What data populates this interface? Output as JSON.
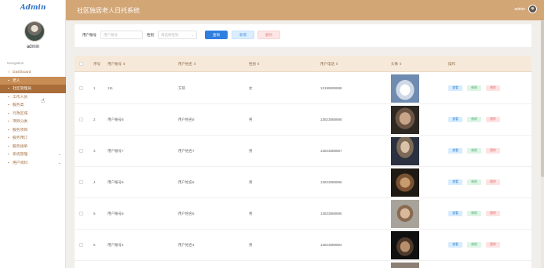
{
  "sidebar": {
    "brand": "Admin",
    "username": "admin",
    "nav_caption": "Navigation",
    "items": [
      {
        "icon": "○",
        "label": "Dashboard",
        "state": "normal",
        "chevron": false
      },
      {
        "icon": "▪",
        "label": "老人",
        "state": "active",
        "chevron": false
      },
      {
        "icon": "▪",
        "label": "社区管理员",
        "state": "active2",
        "chevron": false
      },
      {
        "icon": "▪",
        "label": "工作人员",
        "state": "normal",
        "chevron": false
      },
      {
        "icon": "▪",
        "label": "服务类",
        "state": "normal",
        "chevron": false
      },
      {
        "icon": "▪",
        "label": "行政区域",
        "state": "normal",
        "chevron": false
      },
      {
        "icon": "▪",
        "label": "项目分类",
        "state": "normal",
        "chevron": false
      },
      {
        "icon": "▪",
        "label": "服务项目",
        "state": "normal",
        "chevron": false
      },
      {
        "icon": "▪",
        "label": "服务预订",
        "state": "normal",
        "chevron": false
      },
      {
        "icon": "▪",
        "label": "服务接单",
        "state": "normal",
        "chevron": false
      },
      {
        "icon": "▪",
        "label": "系统管理",
        "state": "normal",
        "chevron": true
      },
      {
        "icon": "▪",
        "label": "用户资料",
        "state": "normal",
        "chevron": true
      }
    ]
  },
  "header": {
    "title": "社区独居老人日托系统",
    "user": "admin"
  },
  "search": {
    "account_label": "用户账号",
    "account_placeholder": "用户账号",
    "gender_label": "性别",
    "gender_placeholder": "请选择性别",
    "search_btn": "查询",
    "add_btn": "新增",
    "delete_btn": "删除"
  },
  "table": {
    "headers": [
      "序号",
      "用户账号 ⇕",
      "用户姓名 ⇕",
      "性别 ⇕",
      "用户电话 ⇕",
      "头像 ⇕",
      "操作"
    ],
    "actions": {
      "view": "查看",
      "edit": "修改",
      "delete": "删除"
    },
    "rows": [
      {
        "no": "1",
        "account": "111",
        "name": "方琼",
        "gender": "女",
        "phone": "13199999888"
      },
      {
        "no": "2",
        "account": "用户账号8",
        "name": "用户姓名8",
        "gender": "男",
        "phone": "13823888888"
      },
      {
        "no": "3",
        "account": "用户账号7",
        "name": "用户姓名7",
        "gender": "男",
        "phone": "13823888887"
      },
      {
        "no": "4",
        "account": "用户账号6",
        "name": "用户姓名6",
        "gender": "男",
        "phone": "13823888886"
      },
      {
        "no": "5",
        "account": "用户账号5",
        "name": "用户姓名5",
        "gender": "男",
        "phone": "13823888885"
      },
      {
        "no": "6",
        "account": "用户账号4",
        "name": "用户姓名4",
        "gender": "男",
        "phone": "13823888884"
      }
    ]
  },
  "colors": {
    "header_bg": "#d3a676",
    "nav_active": "#c88c55",
    "primary": "#2f7fe0"
  }
}
